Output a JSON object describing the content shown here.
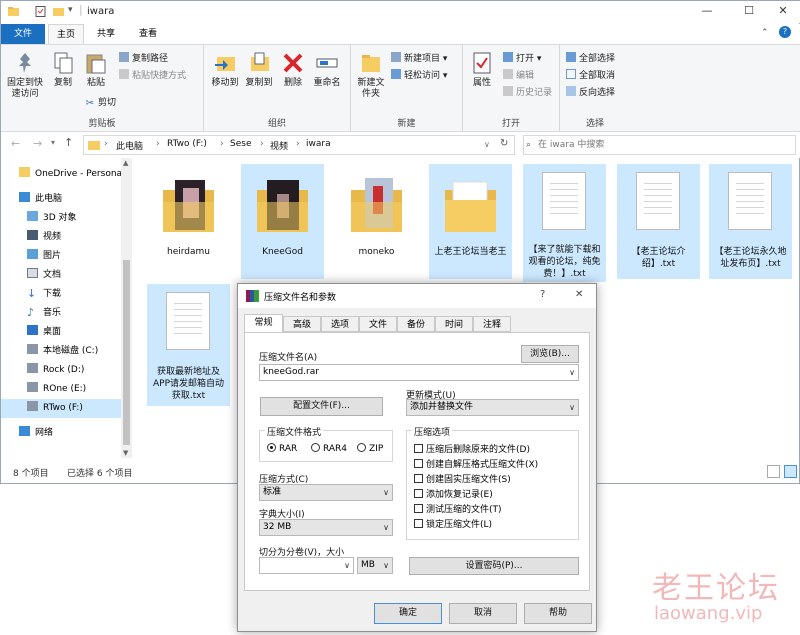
{
  "window": {
    "title": "iwara",
    "minimize": "—",
    "maximize": "☐",
    "close": "✕",
    "help": "?"
  },
  "ribbon_tabs": [
    {
      "label": "文件"
    },
    {
      "label": "主页"
    },
    {
      "label": "共享"
    },
    {
      "label": "查看"
    }
  ],
  "ribbon": {
    "clipboard": {
      "pin": "固定到快速访问",
      "copy": "复制",
      "paste": "粘贴",
      "copy_path": "复制路径",
      "paste_shortcut": "粘贴快捷方式",
      "cut": "剪切",
      "group": "剪贴板"
    },
    "organize": {
      "move_to": "移动到",
      "copy_to": "复制到",
      "delete": "删除",
      "rename": "重命名",
      "group": "组织"
    },
    "new": {
      "new_folder": "新建文件夹",
      "new_item": "新建项目",
      "easy_access": "轻松访问",
      "group": "新建"
    },
    "open": {
      "properties": "属性",
      "open": "打开",
      "edit": "编辑",
      "history": "历史记录",
      "group": "打开"
    },
    "select": {
      "select_all": "全部选择",
      "select_none": "全部取消",
      "invert": "反向选择",
      "group": "选择"
    }
  },
  "address": {
    "crumbs": [
      {
        "label": "此电脑"
      },
      {
        "label": "RTwo (F:)"
      },
      {
        "label": "Sese"
      },
      {
        "label": "视频"
      },
      {
        "label": "iwara"
      }
    ],
    "search_placeholder": "在 iwara 中搜索"
  },
  "nav": [
    {
      "label": "OneDrive - Personal"
    },
    {
      "label": "此电脑"
    },
    {
      "label": "3D 对象"
    },
    {
      "label": "视频"
    },
    {
      "label": "图片"
    },
    {
      "label": "文档"
    },
    {
      "label": "下载"
    },
    {
      "label": "音乐"
    },
    {
      "label": "桌面"
    },
    {
      "label": "本地磁盘 (C:)"
    },
    {
      "label": "Rock (D:)"
    },
    {
      "label": "ROne (E:)"
    },
    {
      "label": "RTwo (F:)"
    },
    {
      "label": "网络"
    }
  ],
  "files": [
    {
      "name": "heirdamu"
    },
    {
      "name": "KneeGod"
    },
    {
      "name": "moneko"
    },
    {
      "name": "上老王论坛当老王"
    },
    {
      "name": "【来了就能下载和观看的论坛，纯免费！】.txt"
    },
    {
      "name": "【老王论坛介绍】.txt"
    },
    {
      "name": "【老王论坛永久地址发布页】.txt"
    },
    {
      "name": "获取最新地址及APP请发邮箱自动获取.txt"
    }
  ],
  "status": {
    "count": "8 个项目",
    "selected": "已选择 6 个项目"
  },
  "dialog": {
    "title": "压缩文件名和参数",
    "tabs": [
      {
        "label": "常规"
      },
      {
        "label": "高级"
      },
      {
        "label": "选项"
      },
      {
        "label": "文件"
      },
      {
        "label": "备份"
      },
      {
        "label": "时间"
      },
      {
        "label": "注释"
      }
    ],
    "archive_name_label": "压缩文件名(A)",
    "browse": "浏览(B)...",
    "archive_name": "kneeGod.rar",
    "profiles": "配置文件(F)...",
    "update_mode_label": "更新模式(U)",
    "update_mode": "添加并替换文件",
    "format_label": "压缩文件格式",
    "formats": [
      {
        "label": "RAR"
      },
      {
        "label": "RAR4"
      },
      {
        "label": "ZIP"
      }
    ],
    "selected_format": "RAR",
    "method_label": "压缩方式(C)",
    "method": "标准",
    "dict_label": "字典大小(I)",
    "dict": "32 MB",
    "split_label": "切分为分卷(V)，大小",
    "split_unit": "MB",
    "options_label": "压缩选项",
    "options": [
      {
        "label": "压缩后删除原来的文件(D)"
      },
      {
        "label": "创建自解压格式压缩文件(X)"
      },
      {
        "label": "创建固实压缩文件(S)"
      },
      {
        "label": "添加恢复记录(E)"
      },
      {
        "label": "测试压缩的文件(T)"
      },
      {
        "label": "锁定压缩文件(L)"
      }
    ],
    "password": "设置密码(P)...",
    "ok": "确定",
    "cancel": "取消",
    "help": "帮助"
  },
  "watermark": {
    "cn": "老王论坛",
    "url": "laowang.vip"
  },
  "colors": {
    "accent": "#1a6fc0",
    "folder": "#f5cd63",
    "selected": "#cce8ff",
    "watermark": "#f0b8b8"
  }
}
